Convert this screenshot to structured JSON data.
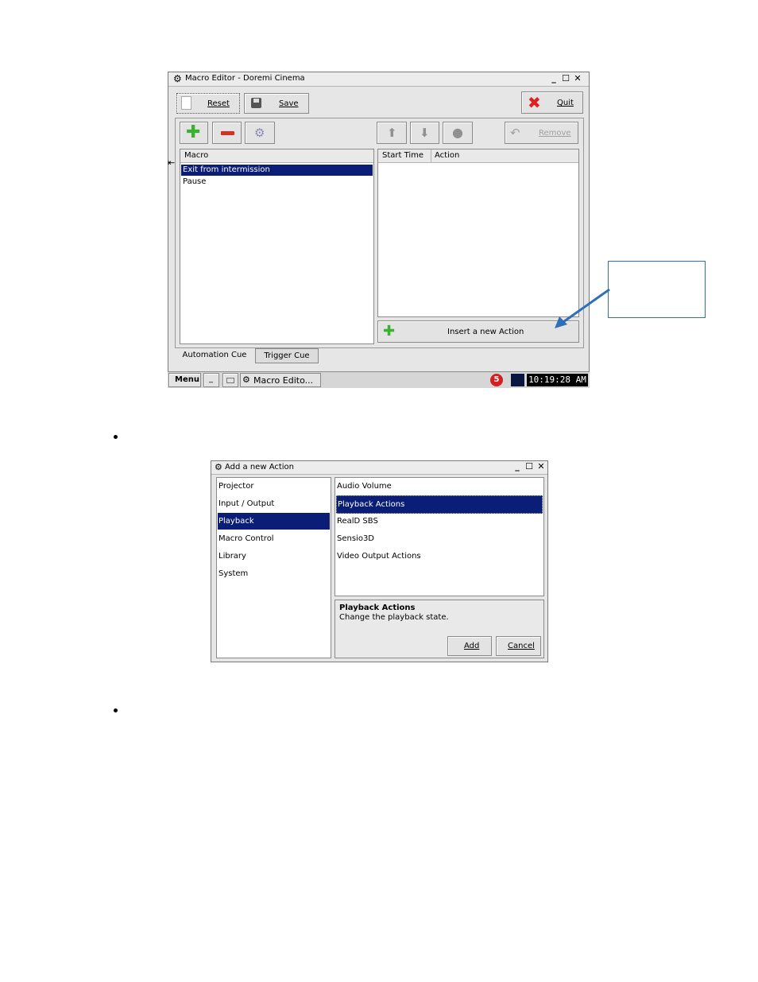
{
  "macro_editor": {
    "title": "Macro Editor - Doremi Cinema",
    "toolbar": {
      "reset": "Reset",
      "save": "Save",
      "quit": "Quit"
    },
    "remove": "Remove",
    "macro_header": "Macro",
    "macros": [
      "Exit from intermission",
      "Pause"
    ],
    "action_headers": [
      "Start Time",
      "Action"
    ],
    "insert_action": "Insert a new Action",
    "tabs": [
      "Automation Cue",
      "Trigger Cue"
    ]
  },
  "taskbar": {
    "menu": "Menu",
    "underscore": "_",
    "task": "Macro Edito...",
    "badge": "5",
    "clock": "10:19:28 AM"
  },
  "add_action": {
    "title": "Add a new Action",
    "categories": [
      "Projector",
      "Input / Output",
      "Playback",
      "Macro Control",
      "Library",
      "System"
    ],
    "actions": [
      "Audio Volume",
      "Playback Actions",
      "RealD SBS",
      "Sensio3D",
      "Video Output Actions"
    ],
    "description_title": "Playback Actions",
    "description_text": "Change the playback state.",
    "add": "Add",
    "cancel": "Cancel"
  },
  "colors": {
    "selection": "#0a1e78",
    "accent_arrow": "#2f6fb5",
    "quit_x": "#e02020",
    "add_green": "#3cb030",
    "remove_red": "#d83020"
  }
}
